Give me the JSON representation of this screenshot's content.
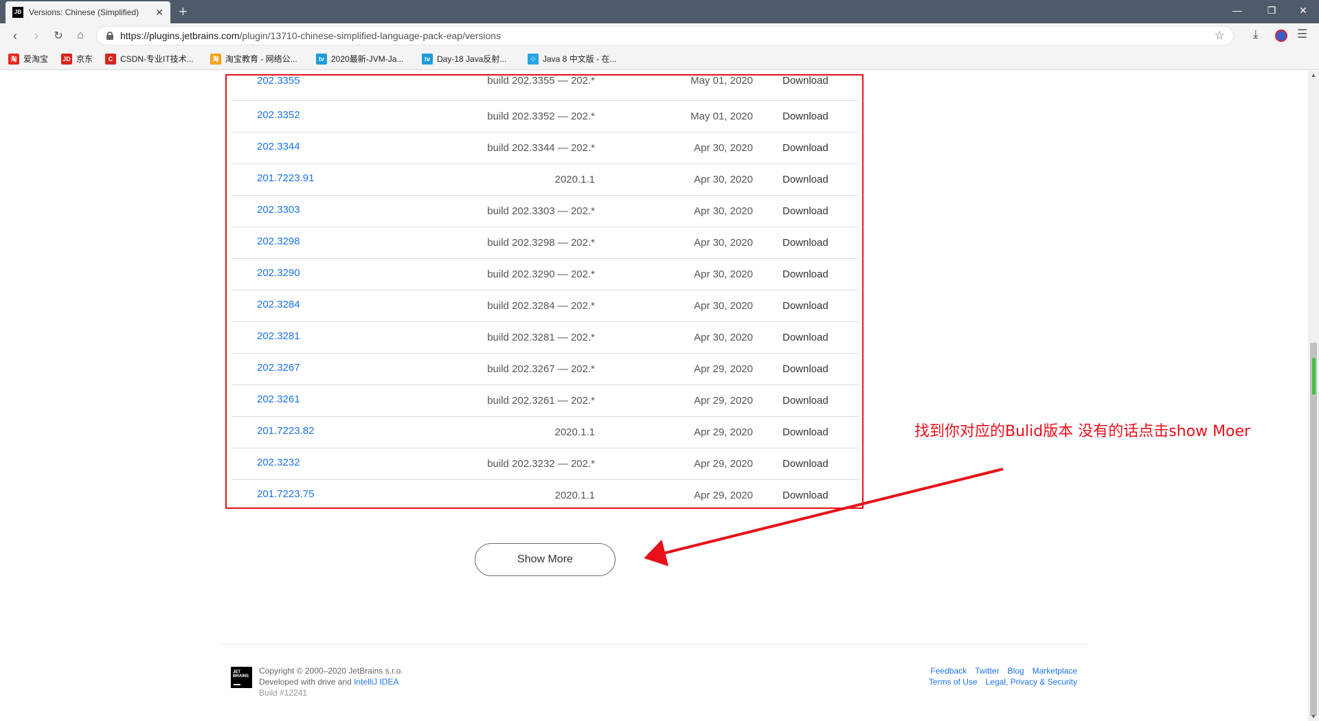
{
  "browser": {
    "tab_title": "Versions: Chinese (Simplified) ",
    "tab_icon_text": "JB",
    "url_host": "https://plugins.jetbrains.com",
    "url_path": "/plugin/13710-chinese-simplified-language-pack-eap/versions",
    "bookmarks": [
      {
        "label": "爱淘宝",
        "icon": "taobao-icon",
        "icon_text": "淘",
        "color": "#e8271a"
      },
      {
        "label": "京东",
        "icon": "jd-icon",
        "icon_text": "JD",
        "color": "#d8241c"
      },
      {
        "label": "CSDN-专业IT技术...",
        "icon": "csdn-icon",
        "icon_text": "C",
        "color": "#d5261f"
      },
      {
        "label": "淘宝教育 - 网络公...",
        "icon": "taobao-edu-icon",
        "icon_text": "淘",
        "color": "#f7a11a"
      },
      {
        "label": "2020最新-JVM-Ja...",
        "icon": "bilibili-icon",
        "icon_text": "tv",
        "color": "#1d9bd8"
      },
      {
        "label": "Day-18 Java反射...",
        "icon": "bilibili-icon",
        "icon_text": "tv",
        "color": "#1d9bd8"
      },
      {
        "label": "Java 8 中文版 - 在...",
        "icon": "runoob-icon",
        "icon_text": "◇",
        "color": "#2aa4e8"
      }
    ]
  },
  "versions": [
    {
      "version": "202.3355",
      "compat": "build 202.3355 — 202.*",
      "date": "May 01, 2020",
      "action": "Download"
    },
    {
      "version": "202.3352",
      "compat": "build 202.3352 — 202.*",
      "date": "May 01, 2020",
      "action": "Download"
    },
    {
      "version": "202.3344",
      "compat": "build 202.3344 — 202.*",
      "date": "Apr 30, 2020",
      "action": "Download"
    },
    {
      "version": "201.7223.91",
      "compat": "2020.1.1",
      "date": "Apr 30, 2020",
      "action": "Download"
    },
    {
      "version": "202.3303",
      "compat": "build 202.3303 — 202.*",
      "date": "Apr 30, 2020",
      "action": "Download"
    },
    {
      "version": "202.3298",
      "compat": "build 202.3298 — 202.*",
      "date": "Apr 30, 2020",
      "action": "Download"
    },
    {
      "version": "202.3290",
      "compat": "build 202.3290 — 202.*",
      "date": "Apr 30, 2020",
      "action": "Download"
    },
    {
      "version": "202.3284",
      "compat": "build 202.3284 — 202.*",
      "date": "Apr 30, 2020",
      "action": "Download"
    },
    {
      "version": "202.3281",
      "compat": "build 202.3281 — 202.*",
      "date": "Apr 30, 2020",
      "action": "Download"
    },
    {
      "version": "202.3267",
      "compat": "build 202.3267 — 202.*",
      "date": "Apr 29, 2020",
      "action": "Download"
    },
    {
      "version": "202.3261",
      "compat": "build 202.3261 — 202.*",
      "date": "Apr 29, 2020",
      "action": "Download"
    },
    {
      "version": "201.7223.82",
      "compat": "2020.1.1",
      "date": "Apr 29, 2020",
      "action": "Download"
    },
    {
      "version": "202.3232",
      "compat": "build 202.3232 — 202.*",
      "date": "Apr 29, 2020",
      "action": "Download"
    },
    {
      "version": "201.7223.75",
      "compat": "2020.1.1",
      "date": "Apr 29, 2020",
      "action": "Download"
    }
  ],
  "show_more_label": "Show More",
  "annotation_text": "找到你对应的Bulid版本 没有的话点击show Moer",
  "annotation_color": "#e8101a",
  "footer": {
    "logo_text": "JET BRAINS",
    "copyright": "Copyright © 2000–2020 JetBrains s.r.o.",
    "developed_prefix": "Developed with drive and ",
    "developed_link": "IntelliJ IDEA",
    "build": "Build #12241",
    "links_row1": [
      "Feedback",
      "Twitter",
      "Blog",
      "Marketplace"
    ],
    "links_row2": [
      "Terms of Use",
      "Legal, Privacy & Security"
    ]
  }
}
